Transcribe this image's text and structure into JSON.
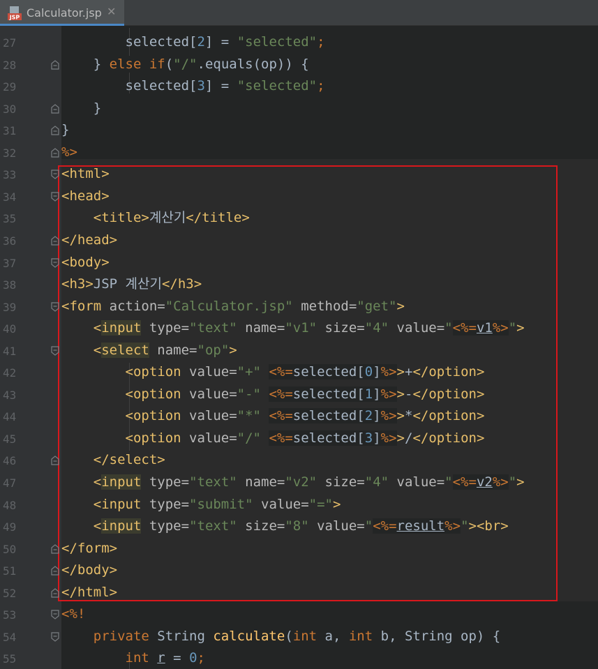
{
  "tab": {
    "title": "Calculator.jsp",
    "icon": "jsp-file-icon",
    "close_glyph": "✕",
    "icon_text": "JSP"
  },
  "lines": [
    {
      "n": "27",
      "parts": [
        [
          "",
          "        selected["
        ],
        [
          "n",
          "2"
        ],
        [
          "",
          "] = "
        ],
        [
          "s",
          "\"selected\""
        ],
        [
          "k",
          ";"
        ]
      ]
    },
    {
      "n": "28",
      "parts": [
        [
          "",
          "    } "
        ],
        [
          "k",
          "else if"
        ],
        [
          "",
          "("
        ],
        [
          "s",
          "\"/\""
        ],
        [
          "",
          ".equals(op)) {"
        ]
      ]
    },
    {
      "n": "29",
      "parts": [
        [
          "",
          "        selected["
        ],
        [
          "n",
          "3"
        ],
        [
          "",
          "] = "
        ],
        [
          "s",
          "\"selected\""
        ],
        [
          "k",
          ";"
        ]
      ]
    },
    {
      "n": "30",
      "parts": [
        [
          "",
          "    }"
        ]
      ]
    },
    {
      "n": "31",
      "parts": [
        [
          "",
          "}"
        ]
      ]
    },
    {
      "n": "32",
      "parts": [
        [
          "d",
          "%>"
        ]
      ]
    },
    {
      "n": "33",
      "parts": [
        [
          "t",
          "<html>"
        ]
      ]
    },
    {
      "n": "34",
      "parts": [
        [
          "t",
          "<head>"
        ]
      ]
    },
    {
      "n": "35",
      "parts": [
        [
          "",
          "    "
        ],
        [
          "t",
          "<title>"
        ],
        [
          "",
          "계산기"
        ],
        [
          "t",
          "</title>"
        ]
      ]
    },
    {
      "n": "36",
      "parts": [
        [
          "t",
          "</head>"
        ]
      ]
    },
    {
      "n": "37",
      "parts": [
        [
          "t",
          "<body>"
        ]
      ]
    },
    {
      "n": "38",
      "parts": [
        [
          "t",
          "<h3>"
        ],
        [
          "",
          "JSP 계산기"
        ],
        [
          "t",
          "</h3>"
        ]
      ]
    },
    {
      "n": "39",
      "parts": [
        [
          "t",
          "<form "
        ],
        [
          "a",
          "action="
        ],
        [
          "s",
          "\"Calculator.jsp\""
        ],
        [
          "a",
          " method="
        ],
        [
          "s",
          "\"get\""
        ],
        [
          "t",
          ">"
        ]
      ]
    },
    {
      "n": "40",
      "parts": [
        [
          "",
          "    "
        ],
        [
          "t",
          "<"
        ],
        [
          "thl",
          "input"
        ],
        [
          "a",
          " type="
        ],
        [
          "s",
          "\"text\""
        ],
        [
          "a",
          " name="
        ],
        [
          "s",
          "\"v1\""
        ],
        [
          "a",
          " size="
        ],
        [
          "s",
          "\"4\""
        ],
        [
          "a",
          " value="
        ],
        [
          "s",
          "\""
        ],
        [
          "dj",
          "<%="
        ],
        [
          "uj",
          "v1"
        ],
        [
          "dj",
          "%>"
        ],
        [
          "s",
          "\""
        ],
        [
          "t",
          ">"
        ]
      ]
    },
    {
      "n": "41",
      "parts": [
        [
          "",
          "    "
        ],
        [
          "t",
          "<"
        ],
        [
          "thl",
          "select"
        ],
        [
          "a",
          " name="
        ],
        [
          "s",
          "\"op\""
        ],
        [
          "t",
          ">"
        ]
      ]
    },
    {
      "n": "42",
      "parts": [
        [
          "",
          "        "
        ],
        [
          "t",
          "<option "
        ],
        [
          "a",
          "value="
        ],
        [
          "s",
          "\"+\""
        ],
        [
          "",
          " "
        ],
        [
          "dj",
          "<%="
        ],
        [
          "j",
          "selected["
        ],
        [
          "nj",
          "0"
        ],
        [
          "j",
          "]"
        ],
        [
          "dj",
          "%>"
        ],
        [
          "t",
          ">"
        ],
        [
          "",
          "+"
        ],
        [
          "t",
          "</option>"
        ]
      ]
    },
    {
      "n": "43",
      "parts": [
        [
          "",
          "        "
        ],
        [
          "t",
          "<option "
        ],
        [
          "a",
          "value="
        ],
        [
          "s",
          "\"-\""
        ],
        [
          "",
          " "
        ],
        [
          "dj",
          "<%="
        ],
        [
          "j",
          "selected["
        ],
        [
          "nj",
          "1"
        ],
        [
          "j",
          "]"
        ],
        [
          "dj",
          "%>"
        ],
        [
          "t",
          ">"
        ],
        [
          "",
          "-"
        ],
        [
          "t",
          "</option>"
        ]
      ]
    },
    {
      "n": "44",
      "parts": [
        [
          "",
          "        "
        ],
        [
          "t",
          "<option "
        ],
        [
          "a",
          "value="
        ],
        [
          "s",
          "\"*\""
        ],
        [
          "",
          " "
        ],
        [
          "dj",
          "<%="
        ],
        [
          "j",
          "selected["
        ],
        [
          "nj",
          "2"
        ],
        [
          "j",
          "]"
        ],
        [
          "dj",
          "%>"
        ],
        [
          "t",
          ">"
        ],
        [
          "",
          "*"
        ],
        [
          "t",
          "</option>"
        ]
      ]
    },
    {
      "n": "45",
      "parts": [
        [
          "",
          "        "
        ],
        [
          "t",
          "<option "
        ],
        [
          "a",
          "value="
        ],
        [
          "s",
          "\"/\""
        ],
        [
          "",
          " "
        ],
        [
          "dj",
          "<%="
        ],
        [
          "j",
          "selected["
        ],
        [
          "nj",
          "3"
        ],
        [
          "j",
          "]"
        ],
        [
          "dj",
          "%>"
        ],
        [
          "t",
          ">"
        ],
        [
          "",
          "/"
        ],
        [
          "t",
          "</option>"
        ]
      ]
    },
    {
      "n": "46",
      "parts": [
        [
          "",
          "    "
        ],
        [
          "t",
          "</select>"
        ]
      ]
    },
    {
      "n": "47",
      "parts": [
        [
          "",
          "    "
        ],
        [
          "t",
          "<"
        ],
        [
          "thl",
          "input"
        ],
        [
          "a",
          " type="
        ],
        [
          "s",
          "\"text\""
        ],
        [
          "a",
          " name="
        ],
        [
          "s",
          "\"v2\""
        ],
        [
          "a",
          " size="
        ],
        [
          "s",
          "\"4\""
        ],
        [
          "a",
          " value="
        ],
        [
          "s",
          "\""
        ],
        [
          "dj",
          "<%="
        ],
        [
          "uj",
          "v2"
        ],
        [
          "dj",
          "%>"
        ],
        [
          "s",
          "\""
        ],
        [
          "t",
          ">"
        ]
      ]
    },
    {
      "n": "48",
      "parts": [
        [
          "",
          "    "
        ],
        [
          "t",
          "<input "
        ],
        [
          "a",
          "type="
        ],
        [
          "s",
          "\"submit\""
        ],
        [
          "a",
          " value="
        ],
        [
          "s",
          "\"=\""
        ],
        [
          "t",
          ">"
        ]
      ]
    },
    {
      "n": "49",
      "parts": [
        [
          "",
          "    "
        ],
        [
          "t",
          "<"
        ],
        [
          "thl",
          "input"
        ],
        [
          "a",
          " type="
        ],
        [
          "s",
          "\"text\""
        ],
        [
          "a",
          " size="
        ],
        [
          "s",
          "\"8\""
        ],
        [
          "a",
          " value="
        ],
        [
          "s",
          "\""
        ],
        [
          "dj",
          "<%="
        ],
        [
          "uj",
          "result"
        ],
        [
          "dj",
          "%>"
        ],
        [
          "s",
          "\""
        ],
        [
          "t",
          "><br>"
        ]
      ]
    },
    {
      "n": "50",
      "parts": [
        [
          "t",
          "</form>"
        ]
      ]
    },
    {
      "n": "51",
      "parts": [
        [
          "t",
          "</body>"
        ]
      ]
    },
    {
      "n": "52",
      "parts": [
        [
          "t",
          "</html>"
        ]
      ]
    },
    {
      "n": "53",
      "parts": [
        [
          "d",
          "<%!"
        ]
      ]
    },
    {
      "n": "54",
      "parts": [
        [
          "",
          "    "
        ],
        [
          "k",
          "private "
        ],
        [
          "",
          "String "
        ],
        [
          "f",
          "calculate"
        ],
        [
          "",
          "("
        ],
        [
          "k",
          "int "
        ],
        [
          "",
          "a, "
        ],
        [
          "k",
          "int "
        ],
        [
          "",
          "b, String op) {"
        ]
      ]
    },
    {
      "n": "55",
      "parts": [
        [
          "",
          "        "
        ],
        [
          "k",
          "int "
        ],
        [
          "u",
          "r"
        ],
        [
          "",
          " = "
        ],
        [
          "n",
          "0"
        ],
        [
          "k",
          ";"
        ]
      ]
    }
  ],
  "top_partial": "    } "
}
